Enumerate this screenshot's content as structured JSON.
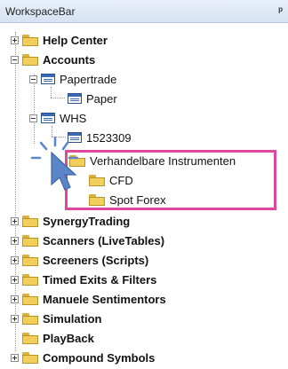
{
  "panel": {
    "title": "WorkspaceBar",
    "pin_glyph": "ᵖ"
  },
  "tree": {
    "help_center": "Help Center",
    "accounts": "Accounts",
    "papertrade": "Papertrade",
    "paper": "Paper",
    "whs": "WHS",
    "account_number": "1523309",
    "tradable_instruments": "Verhandelbare Instrumenten",
    "cfd": "CFD",
    "spot_forex": "Spot Forex",
    "synergy_trading": "SynergyTrading",
    "scanners": "Scanners (LiveTables)",
    "screeners": "Screeners (Scripts)",
    "timed_exits": "Timed Exits & Filters",
    "manual_sentiment": "Manuele Sentimentors",
    "simulation": "Simulation",
    "playback": "PlayBack",
    "compound_symbols": "Compound Symbols"
  },
  "colors": {
    "highlight_border": "#e0479e",
    "cursor_blue": "#5b86c9",
    "folder": "#f1cf5a"
  },
  "icons": {
    "folder": "folder-icon",
    "account": "account-icon",
    "cursor": "mouse-pointer-icon"
  }
}
